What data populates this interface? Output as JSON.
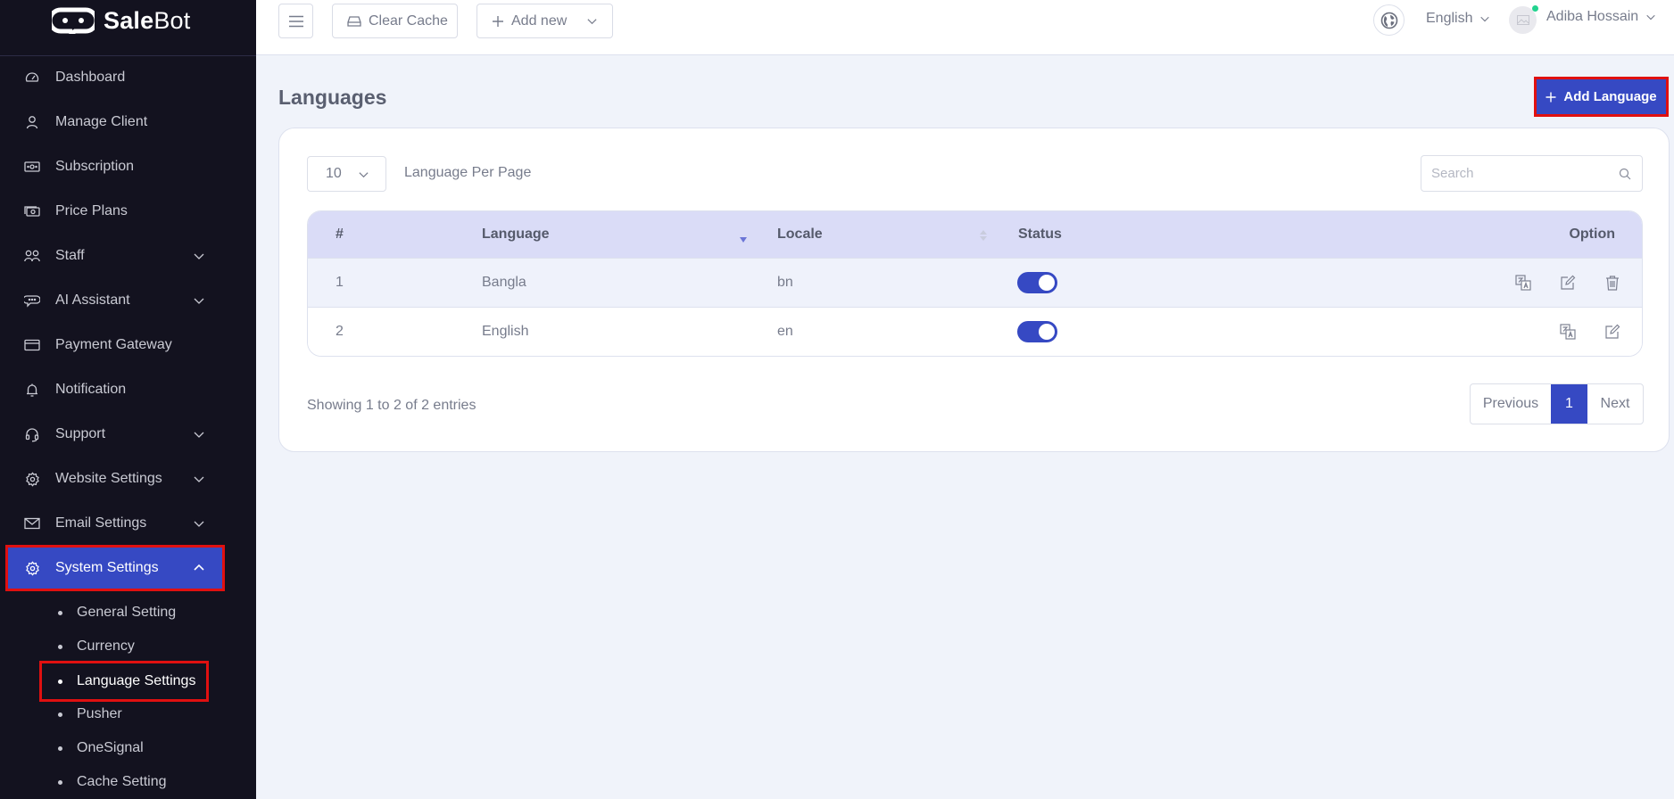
{
  "brand": {
    "name_bold": "Sale",
    "name_light": "Bot"
  },
  "colors": {
    "sidebar_bg": "#13121f",
    "accent": "#3649c3",
    "highlight_outline": "#e01010",
    "page_bg": "#f0f3fa",
    "table_header_bg": "#dadcf7",
    "online": "#22d38f"
  },
  "sidebar": {
    "items": [
      {
        "label": "Dashboard",
        "icon": "dashboard-gauge-icon",
        "has_children": false
      },
      {
        "label": "Manage Client",
        "icon": "user-icon",
        "has_children": false
      },
      {
        "label": "Subscription",
        "icon": "money-icon",
        "has_children": false
      },
      {
        "label": "Price Plans",
        "icon": "money-stack-icon",
        "has_children": false
      },
      {
        "label": "Staff",
        "icon": "users-icon",
        "has_children": true
      },
      {
        "label": "AI Assistant",
        "icon": "chat-bot-icon",
        "has_children": true
      },
      {
        "label": "Payment Gateway",
        "icon": "credit-card-icon",
        "has_children": false
      },
      {
        "label": "Notification",
        "icon": "bell-icon",
        "has_children": false
      },
      {
        "label": "Support",
        "icon": "headset-icon",
        "has_children": true
      },
      {
        "label": "Website Settings",
        "icon": "gear-icon",
        "has_children": true
      },
      {
        "label": "Email Settings",
        "icon": "envelope-icon",
        "has_children": true
      },
      {
        "label": "System Settings",
        "icon": "gear-icon",
        "has_children": true,
        "expanded": true,
        "active": true
      }
    ],
    "sub_items": [
      {
        "label": "General Setting"
      },
      {
        "label": "Currency"
      },
      {
        "label": "Language Settings",
        "active": true
      },
      {
        "label": "Pusher"
      },
      {
        "label": "OneSignal"
      },
      {
        "label": "Cache Setting"
      }
    ]
  },
  "topbar": {
    "clear_cache": "Clear Cache",
    "add_new": "Add new",
    "language": "English",
    "user_name": "Adiba Hossain"
  },
  "main": {
    "title": "Languages",
    "add_button": "Add Language",
    "per_page_value": "10",
    "per_page_label": "Language Per Page",
    "search_placeholder": "Search",
    "table": {
      "headers": [
        "#",
        "Language",
        "Locale",
        "Status",
        "Option"
      ],
      "rows": [
        {
          "num": "1",
          "language": "Bangla",
          "locale": "bn",
          "status": true,
          "options": [
            "translate",
            "edit",
            "delete"
          ]
        },
        {
          "num": "2",
          "language": "English",
          "locale": "en",
          "status": true,
          "options": [
            "translate",
            "edit"
          ]
        }
      ]
    },
    "showing": "Showing 1 to 2 of 2 entries",
    "pagination": {
      "previous": "Previous",
      "current": "1",
      "next": "Next"
    }
  }
}
